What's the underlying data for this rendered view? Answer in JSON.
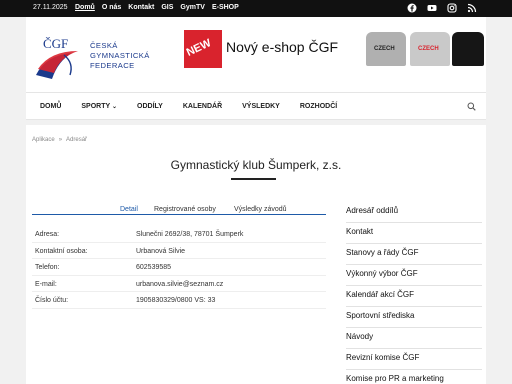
{
  "topbar": {
    "date": "27.11.2025",
    "nav": [
      "Domů",
      "O nás",
      "Kontakt",
      "GIS",
      "GymTV",
      "E-SHOP"
    ],
    "social": [
      "facebook-icon",
      "youtube-icon",
      "instagram-icon",
      "rss-icon"
    ]
  },
  "logo": {
    "mark": "ČGF",
    "lines": [
      "ČESKÁ",
      "GYMNASTICKÁ",
      "FEDERACE"
    ]
  },
  "banner": {
    "badge": "NEW",
    "title": "Nový e-shop ČGF",
    "shirt_texts": [
      "CZECH",
      "CZECH"
    ]
  },
  "mainnav": {
    "items": [
      "DOMŮ",
      "SPORTY",
      "ODDÍLY",
      "KALENDÁŘ",
      "VÝSLEDKY",
      "ROZHODČÍ"
    ]
  },
  "breadcrumb": [
    "Aplikace",
    "»",
    "Adresář"
  ],
  "page": {
    "title": "Gymnastický klub Šumperk, z.s."
  },
  "tabs": [
    "Detail",
    "Registrované osoby",
    "Výsledky závodů"
  ],
  "info": [
    {
      "k": "Adresa:",
      "v": "Slunečni 2692/38, 78701 Šumperk"
    },
    {
      "k": "Kontaktní osoba:",
      "v": "Urbanová Silvie"
    },
    {
      "k": "Telefon:",
      "v": "602539585"
    },
    {
      "k": "E-mail:",
      "v": "urbanova.silvie@seznam.cz"
    },
    {
      "k": "Číslo účtu:",
      "v": "1905830329/0800 VS: 33"
    }
  ],
  "sidebar": [
    "Adresář oddílů",
    "Kontakt",
    "Stanovy a řády ČGF",
    "Výkonný výbor ČGF",
    "Kalendář akcí ČGF",
    "Sportovní střediska",
    "Návody",
    "Revizní komise ČGF",
    "Komise pro PR a marketing"
  ],
  "colors": {
    "accent": "#1e5aa8",
    "brand_red": "#d9232d",
    "topbar": "#111111"
  }
}
